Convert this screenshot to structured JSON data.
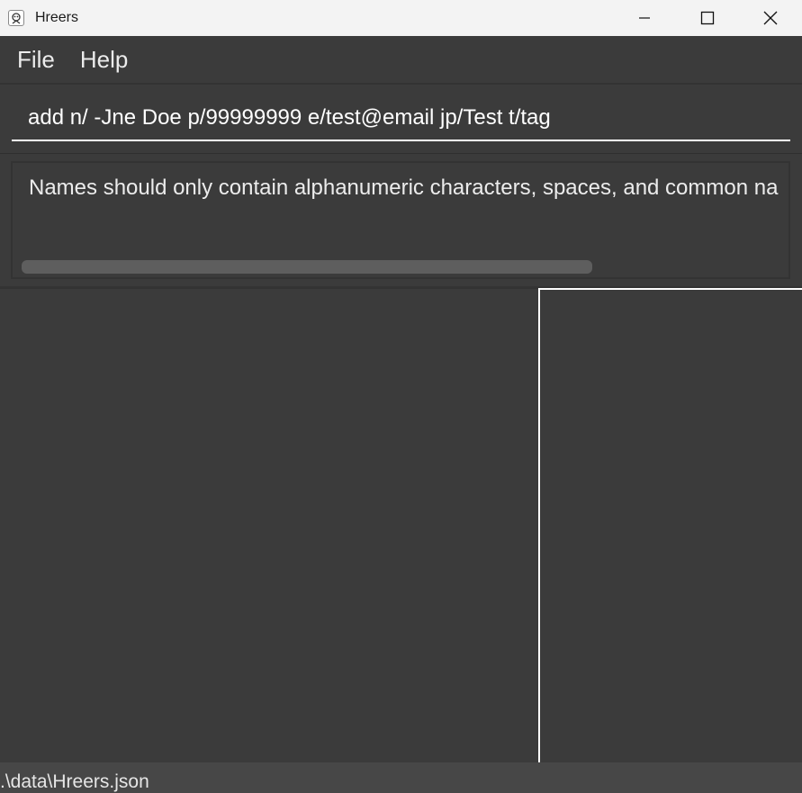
{
  "window": {
    "title": "Hreers"
  },
  "menu": {
    "items": [
      {
        "label": "File"
      },
      {
        "label": "Help"
      }
    ]
  },
  "command_box": {
    "value": "add n/ -Jne Doe p/99999999 e/test@email jp/Test t/tag"
  },
  "result_display": {
    "text": "Names should only contain alphanumeric characters, spaces, and common na"
  },
  "status_bar": {
    "save_location": ".\\data\\Hreers.json"
  },
  "colors": {
    "background": "#3b3b3b",
    "titlebar": "#f3f3f3",
    "status_bar": "#474747",
    "accent_border": "#ffffff"
  }
}
